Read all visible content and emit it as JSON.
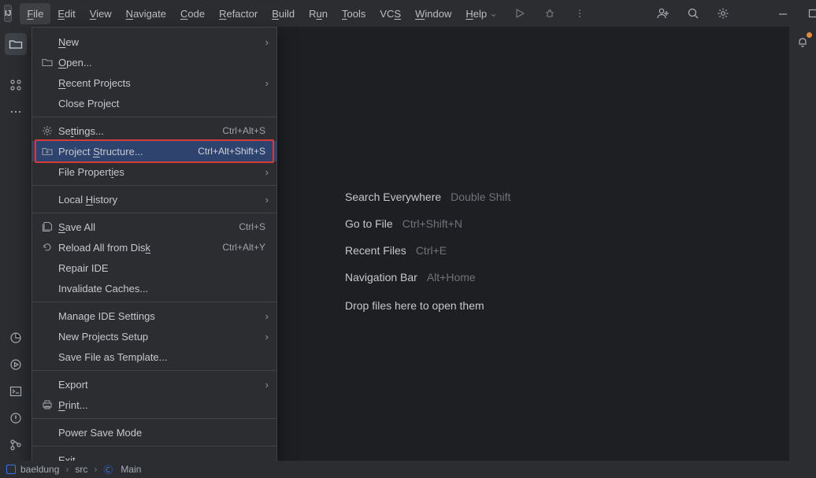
{
  "menubar": {
    "items": [
      {
        "pre": "",
        "mn": "F",
        "post": "ile"
      },
      {
        "pre": "",
        "mn": "E",
        "post": "dit"
      },
      {
        "pre": "",
        "mn": "V",
        "post": "iew"
      },
      {
        "pre": "",
        "mn": "N",
        "post": "avigate"
      },
      {
        "pre": "",
        "mn": "C",
        "post": "ode"
      },
      {
        "pre": "",
        "mn": "R",
        "post": "efactor"
      },
      {
        "pre": "",
        "mn": "B",
        "post": "uild"
      },
      {
        "pre": "R",
        "mn": "u",
        "post": "n"
      },
      {
        "pre": "",
        "mn": "T",
        "post": "ools"
      },
      {
        "pre": "VC",
        "mn": "S",
        "post": ""
      },
      {
        "pre": "",
        "mn": "W",
        "post": "indow"
      },
      {
        "pre": "",
        "mn": "H",
        "post": "elp"
      }
    ]
  },
  "dropdown": [
    {
      "type": "item",
      "label_pre": "",
      "mn": "N",
      "label_post": "ew",
      "submenu": true
    },
    {
      "type": "item",
      "icon": "folder",
      "label_pre": "",
      "mn": "O",
      "label_post": "pen..."
    },
    {
      "type": "item",
      "label_pre": "",
      "mn": "R",
      "label_post": "ecent Projects",
      "submenu": true
    },
    {
      "type": "item",
      "label_pre": "Close Pro",
      "mn": "j",
      "label_post": "ect"
    },
    {
      "type": "sep"
    },
    {
      "type": "item",
      "icon": "gear",
      "label_pre": "Se",
      "mn": "t",
      "label_post": "tings...",
      "shortcut": "Ctrl+Alt+S"
    },
    {
      "type": "item",
      "icon": "structure",
      "label_pre": "Project ",
      "mn": "S",
      "label_post": "tructure...",
      "shortcut": "Ctrl+Alt+Shift+S",
      "selected": true
    },
    {
      "type": "item",
      "label_pre": "File Propert",
      "mn": "i",
      "label_post": "es",
      "submenu": true
    },
    {
      "type": "sep"
    },
    {
      "type": "item",
      "label_pre": "Local ",
      "mn": "H",
      "label_post": "istory",
      "submenu": true
    },
    {
      "type": "sep"
    },
    {
      "type": "item",
      "icon": "saveall",
      "label_pre": "",
      "mn": "S",
      "label_post": "ave All",
      "shortcut": "Ctrl+S"
    },
    {
      "type": "item",
      "icon": "reload",
      "label_pre": "Reload All from Dis",
      "mn": "k",
      "label_post": "",
      "shortcut": "Ctrl+Alt+Y"
    },
    {
      "type": "item",
      "label_pre": "Repair IDE",
      "mn": "",
      "label_post": ""
    },
    {
      "type": "item",
      "label_pre": "Invalidate Caches...",
      "mn": "",
      "label_post": ""
    },
    {
      "type": "sep"
    },
    {
      "type": "item",
      "label_pre": "Manage IDE Settings",
      "mn": "",
      "label_post": "",
      "submenu": true
    },
    {
      "type": "item",
      "label_pre": "New Projects Setup",
      "mn": "",
      "label_post": "",
      "submenu": true
    },
    {
      "type": "item",
      "label_pre": "Save File as Template...",
      "mn": "",
      "label_post": ""
    },
    {
      "type": "sep"
    },
    {
      "type": "item",
      "label_pre": "Export",
      "mn": "",
      "label_post": "",
      "submenu": true
    },
    {
      "type": "item",
      "icon": "printer",
      "label_pre": "",
      "mn": "P",
      "label_post": "rint..."
    },
    {
      "type": "sep"
    },
    {
      "type": "item",
      "label_pre": "Power Save Mode",
      "mn": "",
      "label_post": ""
    },
    {
      "type": "sep"
    },
    {
      "type": "item",
      "label_pre": "E",
      "mn": "x",
      "label_post": "it"
    }
  ],
  "centerTips": [
    {
      "label": "Search Everywhere",
      "shortcut": "Double Shift"
    },
    {
      "label": "Go to File",
      "shortcut": "Ctrl+Shift+N"
    },
    {
      "label": "Recent Files",
      "shortcut": "Ctrl+E"
    },
    {
      "label": "Navigation Bar",
      "shortcut": "Alt+Home"
    }
  ],
  "centerDrop": "Drop files here to open them",
  "status": {
    "project": "baeldung",
    "p1": "src",
    "p2": "Main"
  }
}
